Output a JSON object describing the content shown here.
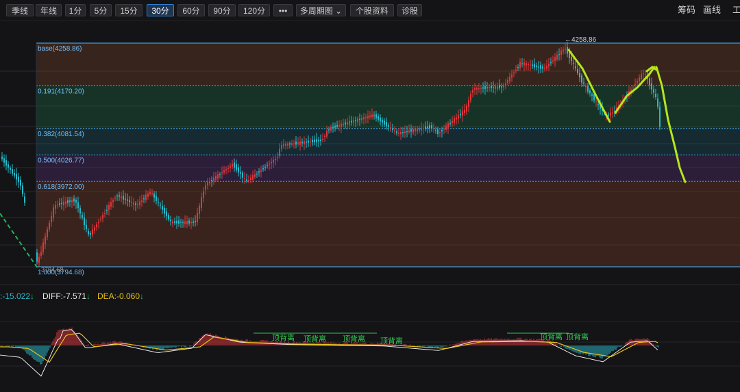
{
  "toolbar": {
    "buttons": [
      {
        "label": "季线"
      },
      {
        "label": "年线"
      },
      {
        "label": "1分"
      },
      {
        "label": "5分"
      },
      {
        "label": "15分"
      },
      {
        "label": "30分"
      },
      {
        "label": "60分"
      },
      {
        "label": "90分"
      },
      {
        "label": "120分"
      },
      {
        "label": "•••"
      },
      {
        "label": "多周期图"
      },
      {
        "label": "个股资料"
      },
      {
        "label": "诊股"
      }
    ],
    "active": "30分",
    "right": [
      "筹码",
      "画线",
      "工"
    ]
  },
  "fib": {
    "levels": [
      {
        "label": "base(4258.86)",
        "price": 4258.86
      },
      {
        "label": "0.191(4170.20)",
        "price": 4170.2
      },
      {
        "label": "0.382(4081.54)",
        "price": 4081.54
      },
      {
        "label": "0.500(4026.77)",
        "price": 4026.77
      },
      {
        "label": "0.618(3972.00)",
        "price": 3972.0
      },
      {
        "label": "1.000(3794.68)",
        "price": 3794.68
      }
    ],
    "high_marker": "←4258.86",
    "low_marker": "3794.68"
  },
  "macd": {
    "first": ":-15.022",
    "diff": "DIFF:-7.571",
    "dea": "DEA:-0.060",
    "divergence_label": "顶背离"
  },
  "colors": {
    "up": "#e0363a",
    "down": "#27b8c8",
    "fib_line": "#4fb3ff",
    "annotation": "#b6e61c",
    "diff": "#e8e8e8",
    "dea": "#e6c21a"
  }
}
